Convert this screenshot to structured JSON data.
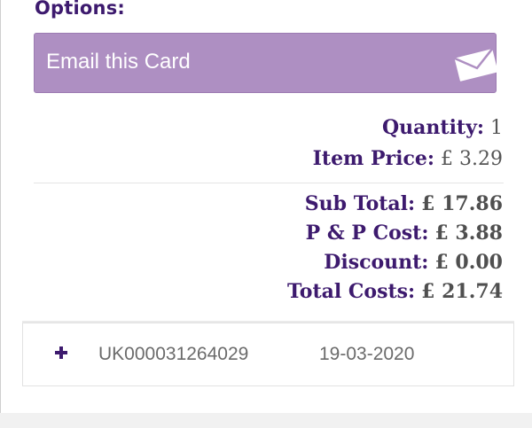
{
  "options": {
    "heading": "Options:",
    "email_button_label": "Email this Card",
    "email_icon": "envelope-icon"
  },
  "item": {
    "quantity_label": "Quantity:",
    "quantity_value": "1",
    "price_label": "Item Price:",
    "price_value": "£ 3.29"
  },
  "totals": {
    "sub_total_label": "Sub Total:",
    "sub_total_value": "£ 17.86",
    "pp_cost_label": "P & P Cost:",
    "pp_cost_value": "£ 3.88",
    "discount_label": "Discount:",
    "discount_value": "£ 0.00",
    "total_label": "Total Costs:",
    "total_value": "£ 21.74"
  },
  "order": {
    "expand_icon": "plus-icon",
    "id": "UK000031264029",
    "date": "19-03-2020"
  },
  "colors": {
    "accent": "#3d1a6e",
    "button_bg": "#ae8fc2"
  }
}
